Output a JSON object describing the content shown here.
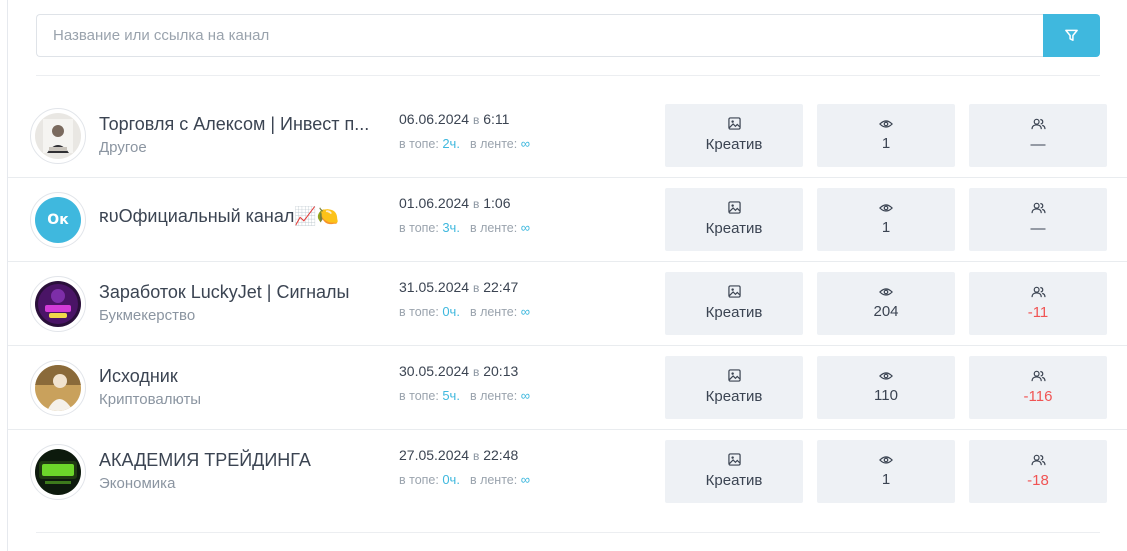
{
  "search": {
    "placeholder": "Название или ссылка на канал",
    "filter_icon": "filter-icon"
  },
  "accent_color": "#3fb8de",
  "negative_color": "#f05454",
  "labels": {
    "in_top": "в топе:",
    "in_feed": "в ленте:",
    "at": "в",
    "creative": "Креатив"
  },
  "rows": [
    {
      "name": "Торговля с Алексом | Инвест п...",
      "category": "Другое",
      "date": "06.06.2024",
      "time": "6:11",
      "top": "2ч.",
      "feed": "∞",
      "views": "1",
      "subs": "—",
      "subs_negative": false,
      "avatar": "photo"
    },
    {
      "name": "ʀᴜОфициальный канал📈🍋",
      "category": "",
      "date": "01.06.2024",
      "time": "1:06",
      "top": "3ч.",
      "feed": "∞",
      "views": "1",
      "subs": "—",
      "subs_negative": false,
      "avatar": "initials",
      "initials": "Ок"
    },
    {
      "name": "Заработок LuckyJet | Сигналы",
      "category": "Букмекерство",
      "date": "31.05.2024",
      "time": "22:47",
      "top": "0ч.",
      "feed": "∞",
      "views": "204",
      "subs": "-11",
      "subs_negative": true,
      "avatar": "photo"
    },
    {
      "name": "Исходник",
      "category": "Криптовалюты",
      "date": "30.05.2024",
      "time": "20:13",
      "top": "5ч.",
      "feed": "∞",
      "views": "110",
      "subs": "-116",
      "subs_negative": true,
      "avatar": "photo"
    },
    {
      "name": "АКАДЕМИЯ ТРЕЙДИНГА",
      "category": "Экономика",
      "date": "27.05.2024",
      "time": "22:48",
      "top": "0ч.",
      "feed": "∞",
      "views": "1",
      "subs": "-18",
      "subs_negative": true,
      "avatar": "photo"
    }
  ]
}
